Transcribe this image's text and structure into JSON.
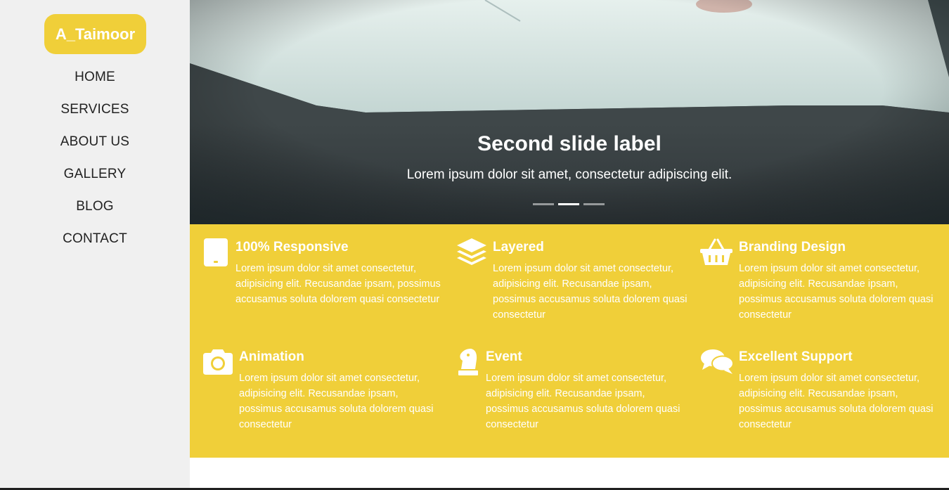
{
  "brand": "A_Taimoor",
  "nav": [
    "HOME",
    "SERVICES",
    "ABOUT US",
    "GALLERY",
    "BLOG",
    "CONTACT"
  ],
  "hero": {
    "title": "Second slide label",
    "subtitle": "Lorem ipsum dolor sit amet, consectetur adipiscing elit.",
    "slide_count": 3,
    "active_slide": 2
  },
  "colors": {
    "accent": "#f0cf39",
    "sidebar_bg": "#f0f0f0",
    "nav_text": "#222222"
  },
  "features": [
    {
      "icon": "tablet-icon",
      "title": "100% Responsive",
      "text": "Lorem ipsum dolor sit amet consectetur, adipisicing elit. Recusandae ipsam, possimus accusamus soluta dolorem quasi consectetur"
    },
    {
      "icon": "layers-icon",
      "title": "Layered",
      "text": "Lorem ipsum dolor sit amet consectetur, adipisicing elit. Recusandae ipsam, possimus accusamus soluta dolorem quasi consectetur"
    },
    {
      "icon": "basket-icon",
      "title": "Branding Design",
      "text": "Lorem ipsum dolor sit amet consectetur, adipisicing elit. Recusandae ipsam, possimus accusamus soluta dolorem quasi consectetur"
    },
    {
      "icon": "camera-icon",
      "title": "Animation",
      "text": "Lorem ipsum dolor sit amet consectetur, adipisicing elit. Recusandae ipsam, possimus accusamus soluta dolorem quasi consectetur"
    },
    {
      "icon": "chess-knight-icon",
      "title": "Event",
      "text": "Lorem ipsum dolor sit amet consectetur, adipisicing elit. Recusandae ipsam, possimus accusamus soluta dolorem quasi consectetur"
    },
    {
      "icon": "comments-icon",
      "title": "Excellent Support",
      "text": "Lorem ipsum dolor sit amet consectetur, adipisicing elit. Recusandae ipsam, possimus accusamus soluta dolorem quasi consectetur"
    }
  ]
}
